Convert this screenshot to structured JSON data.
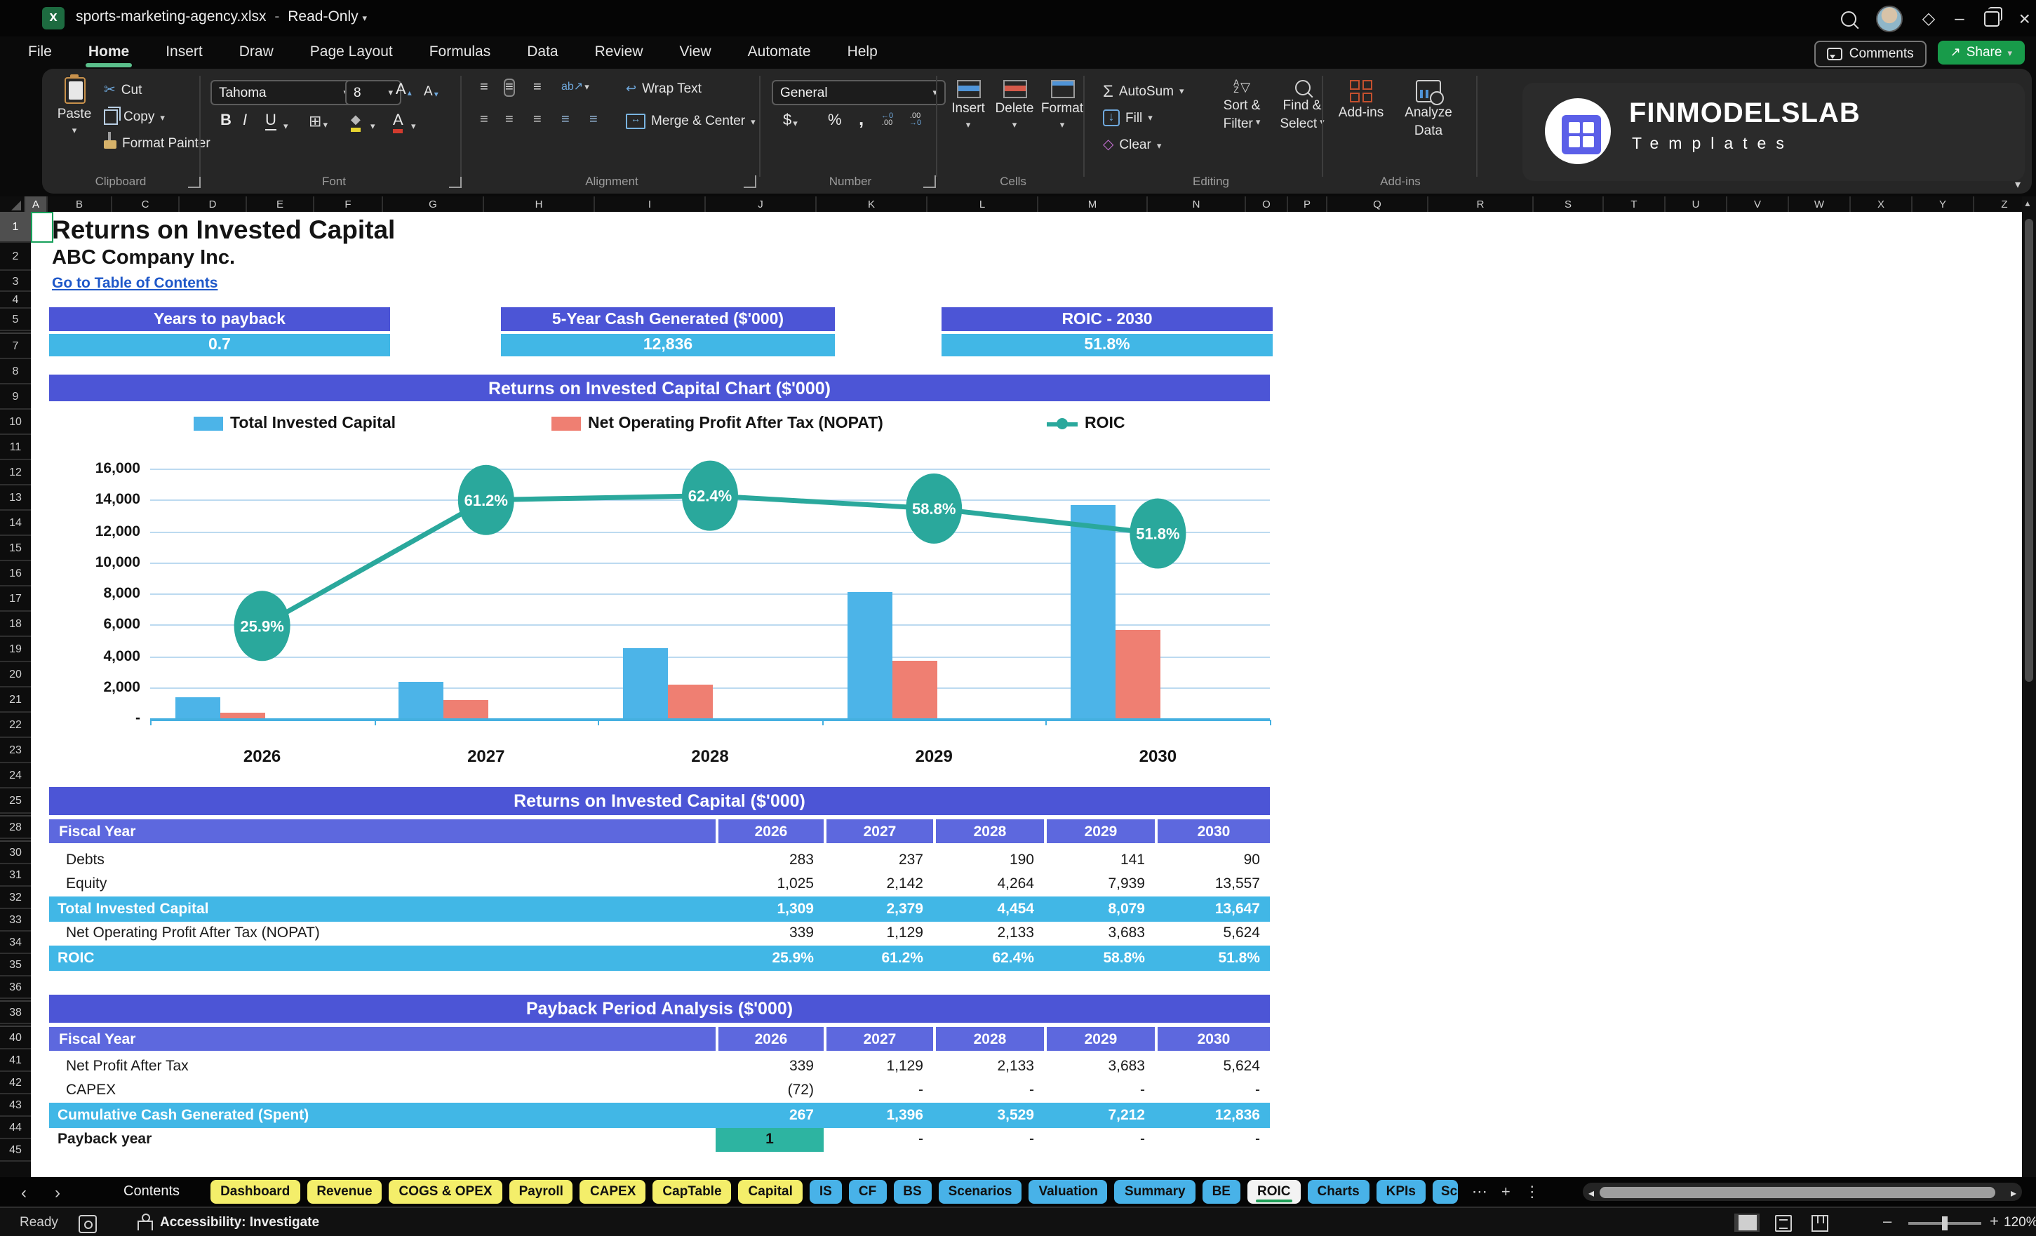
{
  "window": {
    "file_name": "sports-marketing-agency.xlsx",
    "separator": "-",
    "mode": "Read-Only"
  },
  "icons": {
    "chevron_down": "▾",
    "nav_left": "‹",
    "nav_right": "›",
    "ellipsis": "⋯",
    "plus": "+",
    "kebab": "⋮",
    "tri_left": "◂",
    "tri_right": "▸",
    "up_triangle": "▲",
    "scissors": "✂",
    "sigma": "Σ",
    "lines": "≡",
    "wrap_arrow": "↩",
    "arrow_down": "↓",
    "clear_diamond": "◇",
    "funnel": "▽",
    "comma": ",",
    "dollar": "$",
    "percent": "%",
    "premium_diamond": "◇",
    "close": "×",
    "minimize": "–",
    "share_arrow": "↗",
    "orient_ab": "ab↗",
    "borders": "⊞",
    "fill_shape": "◆",
    "excel_x": "x",
    "az_top": "A",
    "az_bot": "Z",
    "inc_top": "←0",
    "inc_bot": ".00",
    "dec_top": ".00",
    "dec_bot": "→0"
  },
  "menu": {
    "items": [
      "File",
      "Home",
      "Insert",
      "Draw",
      "Page Layout",
      "Formulas",
      "Data",
      "Review",
      "View",
      "Automate",
      "Help"
    ],
    "active_index": 1
  },
  "actions": {
    "comments": "Comments",
    "share": "Share"
  },
  "ribbon": {
    "clipboard": {
      "paste": "Paste",
      "cut": "Cut",
      "copy": "Copy",
      "format_painter": "Format Painter",
      "label": "Clipboard"
    },
    "font": {
      "name": "Tahoma",
      "size": "8",
      "bold": "B",
      "italic": "I",
      "underline": "U",
      "grow": "A",
      "shrink": "A",
      "color_a": "A",
      "label": "Font"
    },
    "alignment": {
      "wrap": "Wrap Text",
      "merge": "Merge & Center",
      "label": "Alignment"
    },
    "number": {
      "format": "General",
      "label": "Number"
    },
    "cells": {
      "insert": "Insert",
      "delete": "Delete",
      "format": "Format",
      "label": "Cells"
    },
    "editing": {
      "autosum": "AutoSum",
      "fill": "Fill",
      "clear": "Clear",
      "sort_1": "Sort &",
      "sort_2": "Filter",
      "find_1": "Find &",
      "find_2": "Select",
      "label": "Editing"
    },
    "addins": {
      "addins": "Add-ins",
      "analyze_1": "Analyze",
      "analyze_2": "Data",
      "label": "Add-ins"
    }
  },
  "brand": {
    "name": "FINMODELSLAB",
    "subtitle": "Templates"
  },
  "grid": {
    "columns": [
      "A",
      "B",
      "C",
      "D",
      "E",
      "F",
      "G",
      "H",
      "I",
      "J",
      "K",
      "L",
      "M",
      "N",
      "O",
      "P",
      "Q",
      "R",
      "S",
      "T",
      "U",
      "V",
      "W",
      "X",
      "Y",
      "Z"
    ],
    "rows": [
      "1",
      "2",
      "3",
      "4",
      "5",
      "7",
      "8",
      "9",
      "10",
      "11",
      "12",
      "13",
      "14",
      "15",
      "16",
      "17",
      "18",
      "19",
      "20",
      "21",
      "22",
      "23",
      "24",
      "25",
      "28",
      "30",
      "31",
      "32",
      "33",
      "34",
      "35",
      "36",
      "38",
      "40",
      "41",
      "42",
      "43",
      "44",
      "45"
    ],
    "selected_cell": "A1"
  },
  "page": {
    "title": "Returns on Invested Capital",
    "company": "ABC Company Inc.",
    "link": "Go to Table of Contents"
  },
  "kpis": [
    {
      "label": "Years to payback",
      "value": "0.7"
    },
    {
      "label": "5-Year Cash Generated ($'000)",
      "value": "12,836"
    },
    {
      "label": "ROIC - 2030",
      "value": "51.8%"
    }
  ],
  "chart_data": {
    "type": "bar",
    "title": "Returns on Invested Capital Chart ($'000)",
    "categories": [
      "2026",
      "2027",
      "2028",
      "2029",
      "2030"
    ],
    "series": [
      {
        "name": "Total Invested Capital",
        "type": "bar",
        "color": "#4cb4e8",
        "values": [
          1309,
          2379,
          4454,
          8079,
          13647
        ]
      },
      {
        "name": "Net Operating Profit After Tax (NOPAT)",
        "type": "bar",
        "color": "#ef7f72",
        "values": [
          339,
          1129,
          2133,
          3683,
          5624
        ]
      },
      {
        "name": "ROIC",
        "type": "line",
        "color": "#2aa89c",
        "values": [
          25.9,
          61.2,
          62.4,
          58.8,
          51.8
        ],
        "labels": [
          "25.9%",
          "61.2%",
          "62.4%",
          "58.8%",
          "51.8%"
        ]
      }
    ],
    "y_axis": {
      "max": 16000,
      "step": 2000,
      "labels": [
        "16,000",
        "14,000",
        "12,000",
        "10,000",
        "8,000",
        "6,000",
        "4,000",
        "2,000",
        "-"
      ]
    },
    "secondary_y_axis": {
      "max": 70,
      "unit": "%"
    },
    "legend_position": "top",
    "grid": true
  },
  "tables": [
    {
      "title": "Returns on Invested Capital ($'000)",
      "header": {
        "label": "Fiscal Year",
        "years": [
          "2026",
          "2027",
          "2028",
          "2029",
          "2030"
        ]
      },
      "rows": [
        {
          "label": "Debts",
          "values": [
            "283",
            "237",
            "190",
            "141",
            "90"
          ],
          "style": "normal"
        },
        {
          "label": "Equity",
          "values": [
            "1,025",
            "2,142",
            "4,264",
            "7,939",
            "13,557"
          ],
          "style": "normal"
        },
        {
          "label": "Total Invested Capital",
          "values": [
            "1,309",
            "2,379",
            "4,454",
            "8,079",
            "13,647"
          ],
          "style": "highlight"
        },
        {
          "label": "Net Operating Profit After Tax (NOPAT)",
          "values": [
            "339",
            "1,129",
            "2,133",
            "3,683",
            "5,624"
          ],
          "style": "normal"
        },
        {
          "label": "ROIC",
          "values": [
            "25.9%",
            "61.2%",
            "62.4%",
            "58.8%",
            "51.8%"
          ],
          "style": "highlight"
        }
      ]
    },
    {
      "title": "Payback Period Analysis ($'000)",
      "header": {
        "label": "Fiscal Year",
        "years": [
          "2026",
          "2027",
          "2028",
          "2029",
          "2030"
        ]
      },
      "rows": [
        {
          "label": "Net Profit After Tax",
          "values": [
            "339",
            "1,129",
            "2,133",
            "3,683",
            "5,624"
          ],
          "style": "normal"
        },
        {
          "label": "CAPEX",
          "values": [
            "(72)",
            "-",
            "-",
            "-",
            "-"
          ],
          "style": "normal"
        },
        {
          "label": "Cumulative Cash Generated (Spent)",
          "values": [
            "267",
            "1,396",
            "3,529",
            "7,212",
            "12,836"
          ],
          "style": "highlight"
        },
        {
          "label": "Payback year",
          "values": [
            "1",
            "-",
            "-",
            "-",
            "-"
          ],
          "style": "payback"
        }
      ]
    }
  ],
  "sheet_tabs": {
    "contents_label": "Contents",
    "tabs": [
      {
        "label": "Dashboard",
        "color": "yellow"
      },
      {
        "label": "Revenue",
        "color": "yellow"
      },
      {
        "label": "COGS & OPEX",
        "color": "yellow"
      },
      {
        "label": "Payroll",
        "color": "yellow"
      },
      {
        "label": "CAPEX",
        "color": "yellow"
      },
      {
        "label": "CapTable",
        "color": "yellow"
      },
      {
        "label": "Capital",
        "color": "yellow"
      },
      {
        "label": "IS",
        "color": "blue"
      },
      {
        "label": "CF",
        "color": "blue"
      },
      {
        "label": "BS",
        "color": "blue"
      },
      {
        "label": "Scenarios",
        "color": "blue"
      },
      {
        "label": "Valuation",
        "color": "blue"
      },
      {
        "label": "Summary",
        "color": "blue"
      },
      {
        "label": "BE",
        "color": "blue"
      },
      {
        "label": "ROIC",
        "color": "active"
      },
      {
        "label": "Charts",
        "color": "blue"
      },
      {
        "label": "KPIs",
        "color": "blue"
      },
      {
        "label": "Sc",
        "color": "blue",
        "cut": true
      }
    ]
  },
  "status_bar": {
    "ready": "Ready",
    "accessibility": "Accessibility: Investigate",
    "zoom": "120%"
  },
  "colors": {
    "indigo": "#4c55d6",
    "indigo_light": "#5d68de",
    "cyan": "#41b7e6",
    "bar_blue": "#4cb4e8",
    "bar_red": "#ef7f72",
    "teal": "#2aa89c",
    "payback_teal": "#2db4a1",
    "link": "#1f58c9",
    "tab_yellow": "#f4ee6a",
    "tab_blue": "#48b2e8",
    "green_accent": "#1e9e57"
  }
}
